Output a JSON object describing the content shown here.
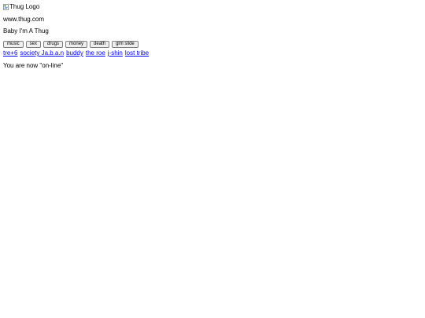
{
  "header": {
    "logo_alt": "Thug Logo",
    "site_url": "www.thug.com",
    "tagline": "Baby I'm A Thug"
  },
  "tags": [
    {
      "label": "music"
    },
    {
      "label": "sex"
    },
    {
      "label": "drugs"
    },
    {
      "label": "money"
    },
    {
      "label": "death"
    },
    {
      "label": "glm slide"
    }
  ],
  "links": [
    {
      "label": "tre+6"
    },
    {
      "label": "society Ja.b.a.n"
    },
    {
      "label": "buddy"
    },
    {
      "label": "the roe"
    },
    {
      "label": "j-shin"
    },
    {
      "label": "lost tribe"
    }
  ],
  "status": {
    "message": "You are now \"on-line\""
  },
  "colors": {
    "link": "#0000ee",
    "button_bg": "#efefef",
    "button_border": "#7f7f7f"
  },
  "icons": {
    "logo_placeholder": "broken-image-icon"
  }
}
